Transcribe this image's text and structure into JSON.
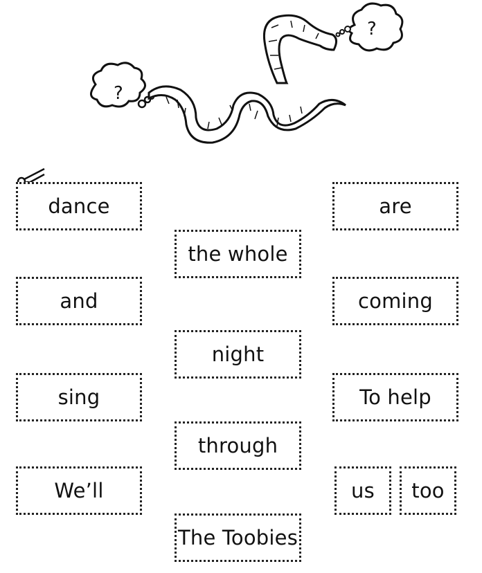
{
  "cards": [
    {
      "text": "dance"
    },
    {
      "text": "and"
    },
    {
      "text": "sing"
    },
    {
      "text": "We’ll"
    },
    {
      "text": "the whole"
    },
    {
      "text": "night"
    },
    {
      "text": "through"
    },
    {
      "text": "The Toobies"
    },
    {
      "text": "are"
    },
    {
      "text": "coming"
    },
    {
      "text": "To help"
    },
    {
      "text": "us"
    },
    {
      "text": "too"
    }
  ],
  "thought_bubbles": [
    {
      "text": "?"
    },
    {
      "text": "?"
    }
  ],
  "icons": [
    "snake-icon",
    "worm-icon",
    "thought-bubble-icon",
    "scissors-icon"
  ]
}
